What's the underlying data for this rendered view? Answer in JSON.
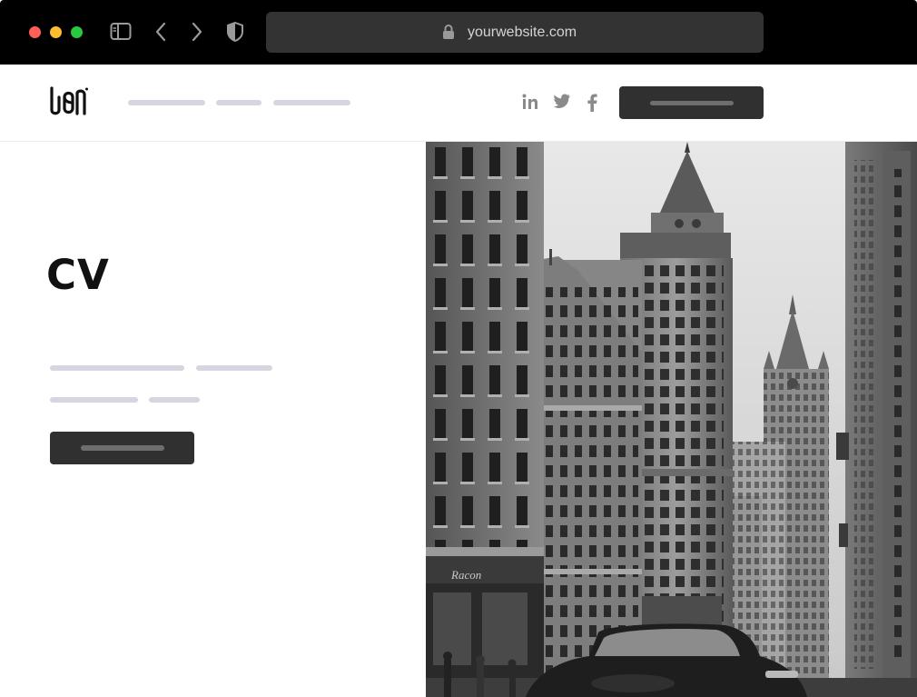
{
  "browser": {
    "url": "yourwebsite.com",
    "icons": [
      "sidebar-toggle-icon",
      "chevron-left-icon",
      "chevron-right-icon",
      "shield-icon",
      "lock-icon"
    ]
  },
  "header": {
    "logo": "logo",
    "social": [
      "linkedin-icon",
      "twitter-icon",
      "facebook-icon"
    ]
  },
  "hero": {
    "title": "CV"
  },
  "photo": {
    "storefront_text": "Racon"
  },
  "colors": {
    "chrome": "#000000",
    "url_bar": "#333333",
    "button": "#303030",
    "placeholder": "#d6d5e0"
  }
}
